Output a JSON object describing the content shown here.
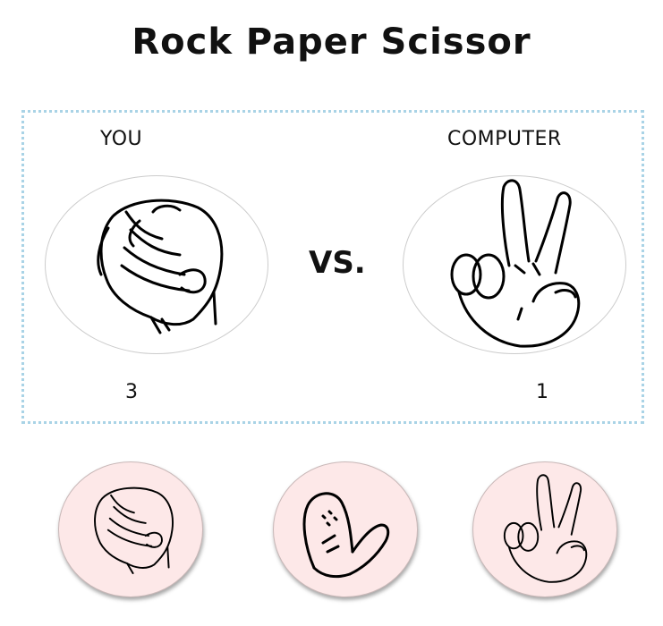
{
  "title": "Rock Paper Scissor",
  "board": {
    "you_label": "YOU",
    "computer_label": "COMPUTER",
    "vs_label": "VS.",
    "you_score": "3",
    "computer_score": "1",
    "you_hand": "rock-hand-icon",
    "computer_hand": "scissor-hand-icon"
  },
  "choices": [
    {
      "name": "rock",
      "icon": "rock-hand-icon"
    },
    {
      "name": "paper",
      "icon": "paper-hand-icon"
    },
    {
      "name": "scissor",
      "icon": "scissor-hand-icon"
    }
  ],
  "colors": {
    "board_border": "#a9d3e6",
    "choice_bg": "#fde8e8",
    "oval_border": "#cccccc"
  }
}
